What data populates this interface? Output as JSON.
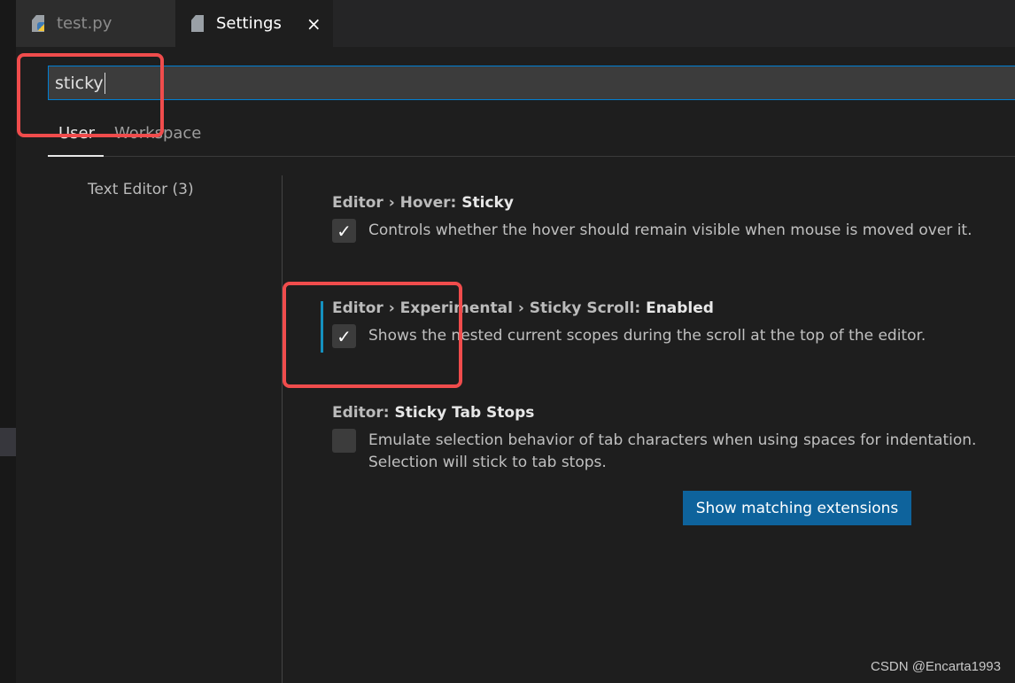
{
  "tabs": [
    {
      "label": "test.py",
      "icon": "python-file-icon",
      "active": false
    },
    {
      "label": "Settings",
      "icon": "file-icon",
      "active": true
    }
  ],
  "close_icon": "×",
  "search": {
    "value": "sticky"
  },
  "scope_tabs": {
    "user": "User",
    "workspace": "Workspace",
    "active": "User"
  },
  "toc": {
    "item": "Text Editor (3)"
  },
  "settings": [
    {
      "prefix": "Editor › Hover: ",
      "name": "Sticky",
      "description": "Controls whether the hover should remain visible when mouse is moved over it.",
      "checked": true
    },
    {
      "prefix": "Editor › Experimental › Sticky Scroll: ",
      "name": "Enabled",
      "description": "Shows the nested current scopes during the scroll at the top of the editor.",
      "checked": true
    },
    {
      "prefix": "Editor: ",
      "name": "Sticky Tab Stops",
      "description": "Emulate selection behavior of tab characters when using spaces for indentation. Selection will stick to tab stops.",
      "checked": false
    }
  ],
  "check_mark": "✓",
  "extensions_button": "Show matching extensions",
  "watermark": "CSDN @Encarta1993",
  "colors": {
    "accent": "#007fd4",
    "button": "#0e639c",
    "annotation": "#f04c4c"
  }
}
